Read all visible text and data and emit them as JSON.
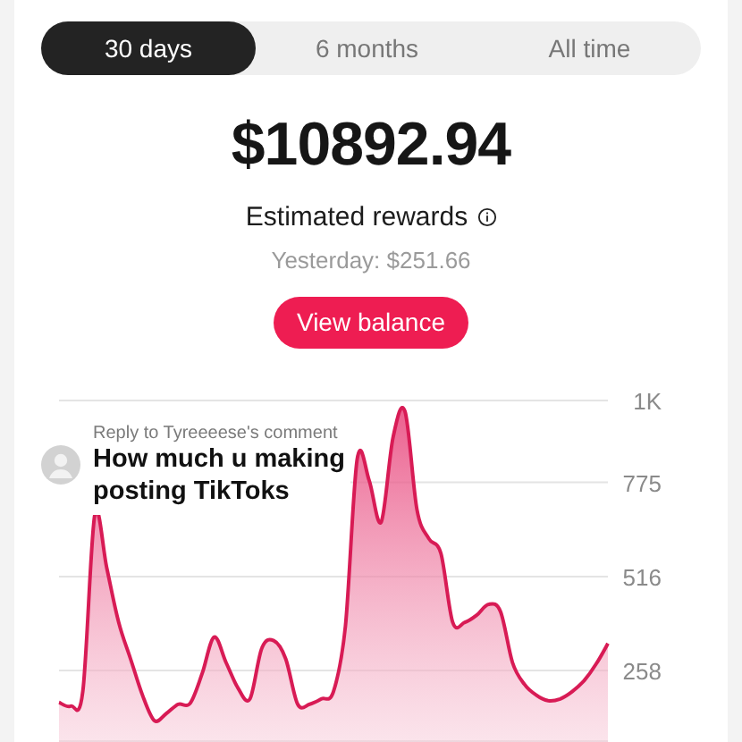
{
  "tabs": [
    {
      "label": "30 days",
      "selected": true
    },
    {
      "label": "6 months",
      "selected": false
    },
    {
      "label": "All time",
      "selected": false
    }
  ],
  "amount": "$10892.94",
  "amount_label": "Estimated rewards",
  "yesterday": "Yesterday: $251.66",
  "button": "View balance",
  "chart": {
    "chart_data": {
      "type": "area",
      "grid": true,
      "ylim": [
        61.4,
        1000
      ],
      "yticks": [
        {
          "value": 1000,
          "label": "1K"
        },
        {
          "value": 775,
          "label": "775"
        },
        {
          "value": 516,
          "label": "516"
        },
        {
          "value": 258,
          "label": "258"
        }
      ],
      "series": [
        {
          "color": "#d81b55",
          "values": [
            170,
            160,
            200,
            685,
            540,
            390,
            290,
            190,
            120,
            140,
            165,
            168,
            250,
            350,
            280,
            210,
            180,
            320,
            340,
            290,
            165,
            165,
            180,
            200,
            380,
            840,
            780,
            666,
            900,
            970,
            700,
            620,
            580,
            390,
            390,
            410,
            440,
            420,
            280,
            220,
            190,
            175,
            180,
            200,
            230,
            275,
            332
          ]
        }
      ]
    }
  },
  "comment": {
    "reply_to": "Reply to Tyreeeese's comment",
    "text": "How much u making posting TikToks"
  }
}
